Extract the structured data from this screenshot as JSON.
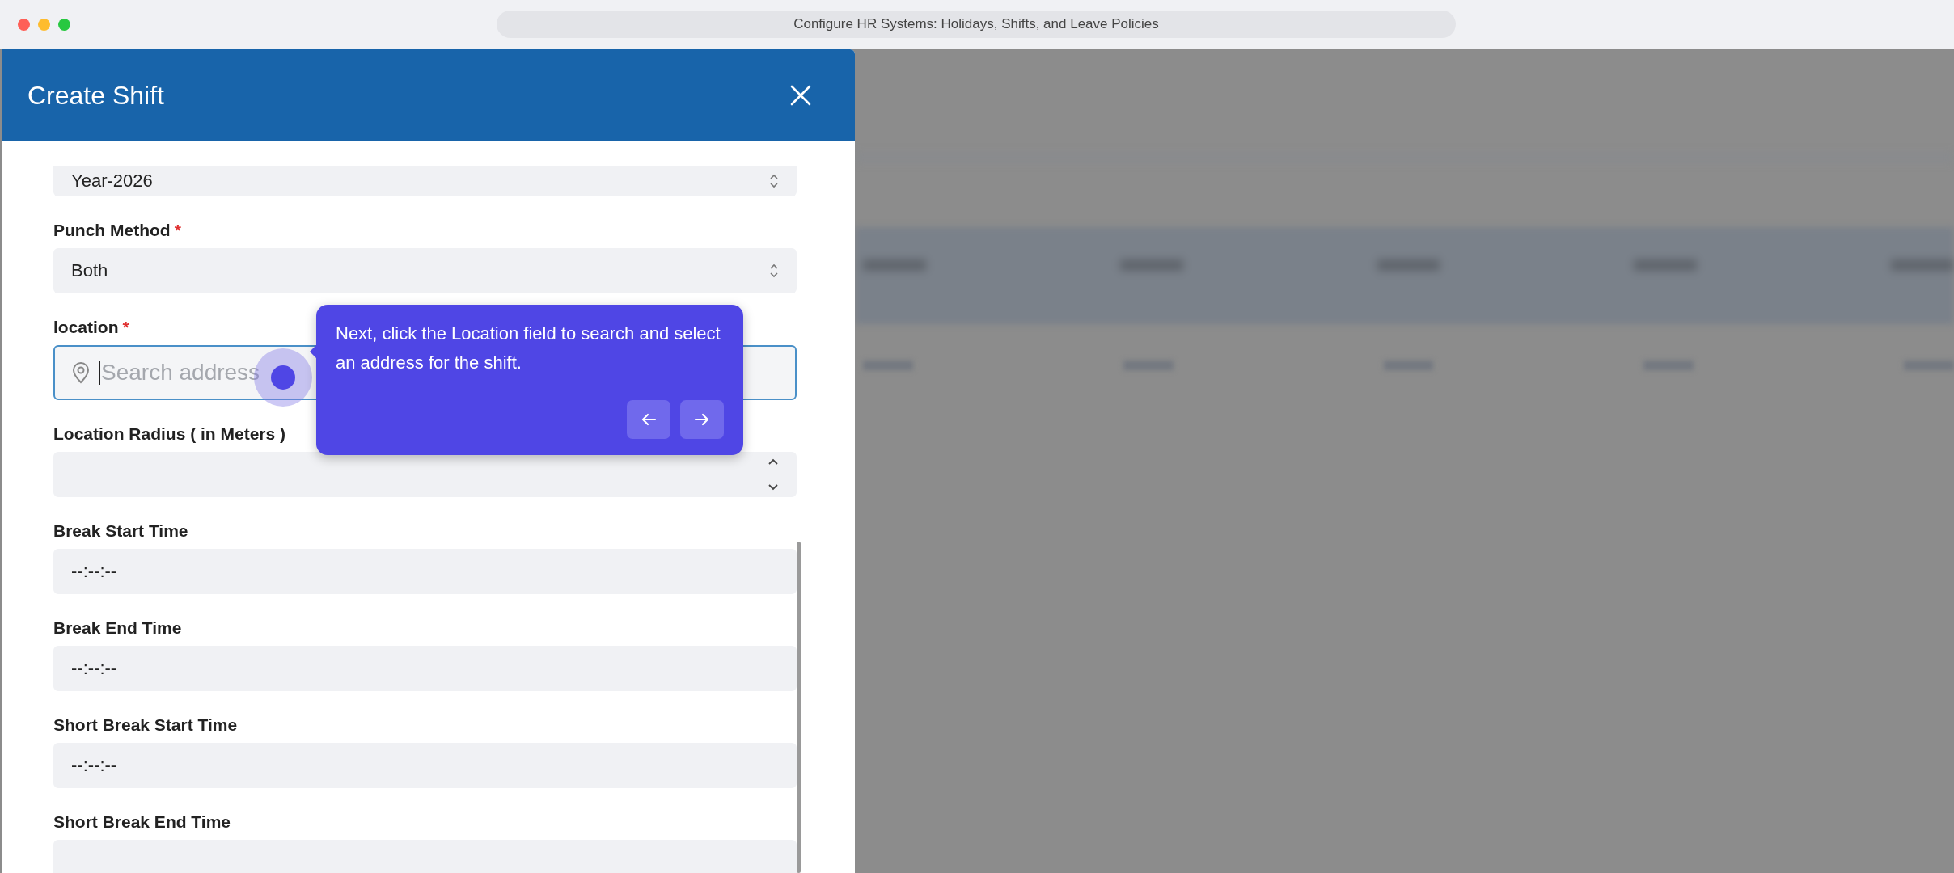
{
  "window": {
    "title": "Configure HR Systems: Holidays, Shifts, and Leave Policies"
  },
  "dialog": {
    "title": "Create Shift",
    "fields": [
      {
        "kind": "select",
        "value": "Year-2026",
        "focused": false
      },
      {
        "kind": "select",
        "label": "Punch Method",
        "required_mark": "*",
        "value": "Both",
        "focused": false
      },
      {
        "kind": "search",
        "label": "location",
        "required_mark": "*",
        "placeholder": "Search address",
        "focused": true
      },
      {
        "kind": "number",
        "label": "Location Radius ( in Meters )",
        "focused": false
      },
      {
        "kind": "time",
        "label": "Break Start Time",
        "value": "--:--:--",
        "focused": false
      },
      {
        "kind": "time",
        "label": "Break End Time",
        "value": "--:--:--",
        "focused": false
      },
      {
        "kind": "time",
        "label": "Short Break Start Time",
        "value": "--:--:--",
        "focused": false
      },
      {
        "kind": "time",
        "label": "Short Break End Time",
        "focused": false
      }
    ]
  },
  "tooltip": {
    "text": "Next, click the Location field to search and select an address for the shift."
  }
}
